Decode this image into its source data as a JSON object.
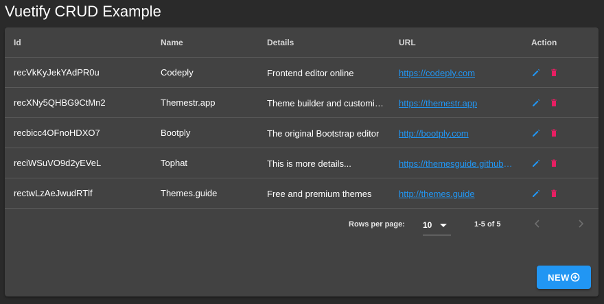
{
  "page": {
    "title": "Vuetify CRUD Example"
  },
  "table": {
    "headers": {
      "id": "Id",
      "name": "Name",
      "details": "Details",
      "url": "URL",
      "action": "Action"
    },
    "rows": [
      {
        "id": "recVkKyJekYAdPR0u",
        "name": "Codeply",
        "details": "Frontend editor online",
        "url": "https://codeply.com"
      },
      {
        "id": "recXNy5QHBG9CtMn2",
        "name": "Themestr.app",
        "details": "Theme builder and customizer",
        "url": "https://themestr.app"
      },
      {
        "id": "recbicc4OFnoHDXO7",
        "name": "Bootply",
        "details": "The original Bootstrap editor",
        "url": "http://bootply.com"
      },
      {
        "id": "reciWSuVO9d2yEVeL",
        "name": "Tophat",
        "details": "This is more details...",
        "url": "https://themesguide.github.io"
      },
      {
        "id": "rectwLzAeJwudRTlf",
        "name": "Themes.guide",
        "details": "Free and premium themes",
        "url": "http://themes.guide"
      }
    ],
    "edit_icon": "pencil-icon",
    "delete_icon": "trash-icon"
  },
  "pagination": {
    "rows_per_page_label": "Rows per page:",
    "rows_per_page_value": "10",
    "range": "1-5 of 5"
  },
  "actions": {
    "new_label": "NEW"
  },
  "colors": {
    "accent": "#2196f3",
    "delete": "#e91e63",
    "background": "#2a2a2a",
    "card": "#424242"
  }
}
